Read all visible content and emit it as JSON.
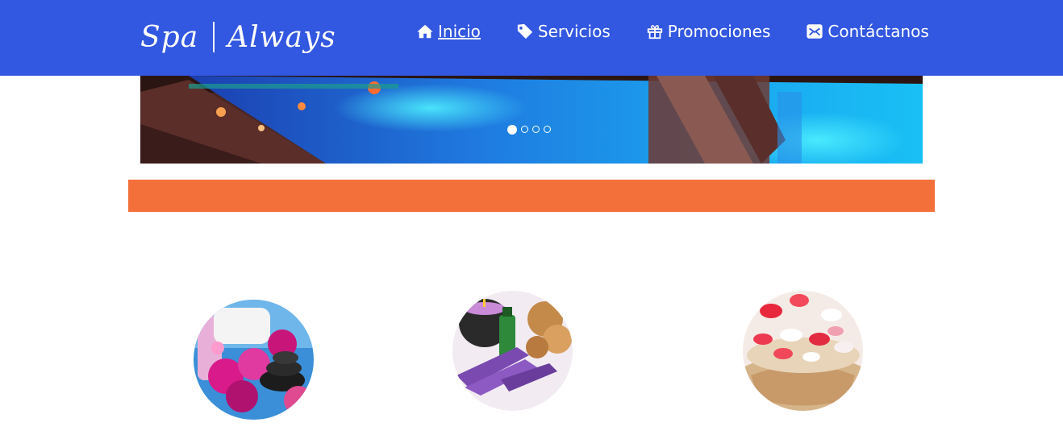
{
  "brand": {
    "part1": "Spa",
    "part2": "Always"
  },
  "nav": {
    "items": [
      {
        "label": "Inicio",
        "icon": "home-icon",
        "active": true
      },
      {
        "label": "Servicios",
        "icon": "tag-icon"
      },
      {
        "label": "Promociones",
        "icon": "gift-icon"
      },
      {
        "label": "Contáctanos",
        "icon": "envelope-icon"
      }
    ]
  },
  "carousel": {
    "slides": 4,
    "current": 1
  },
  "colors": {
    "navbar": "#3257e0",
    "band": "#f4703a",
    "nav_text": "#ffffff"
  },
  "gallery": [
    "orchids-stones-spa",
    "candle-oil-lavender",
    "rose-petals-bowl"
  ]
}
